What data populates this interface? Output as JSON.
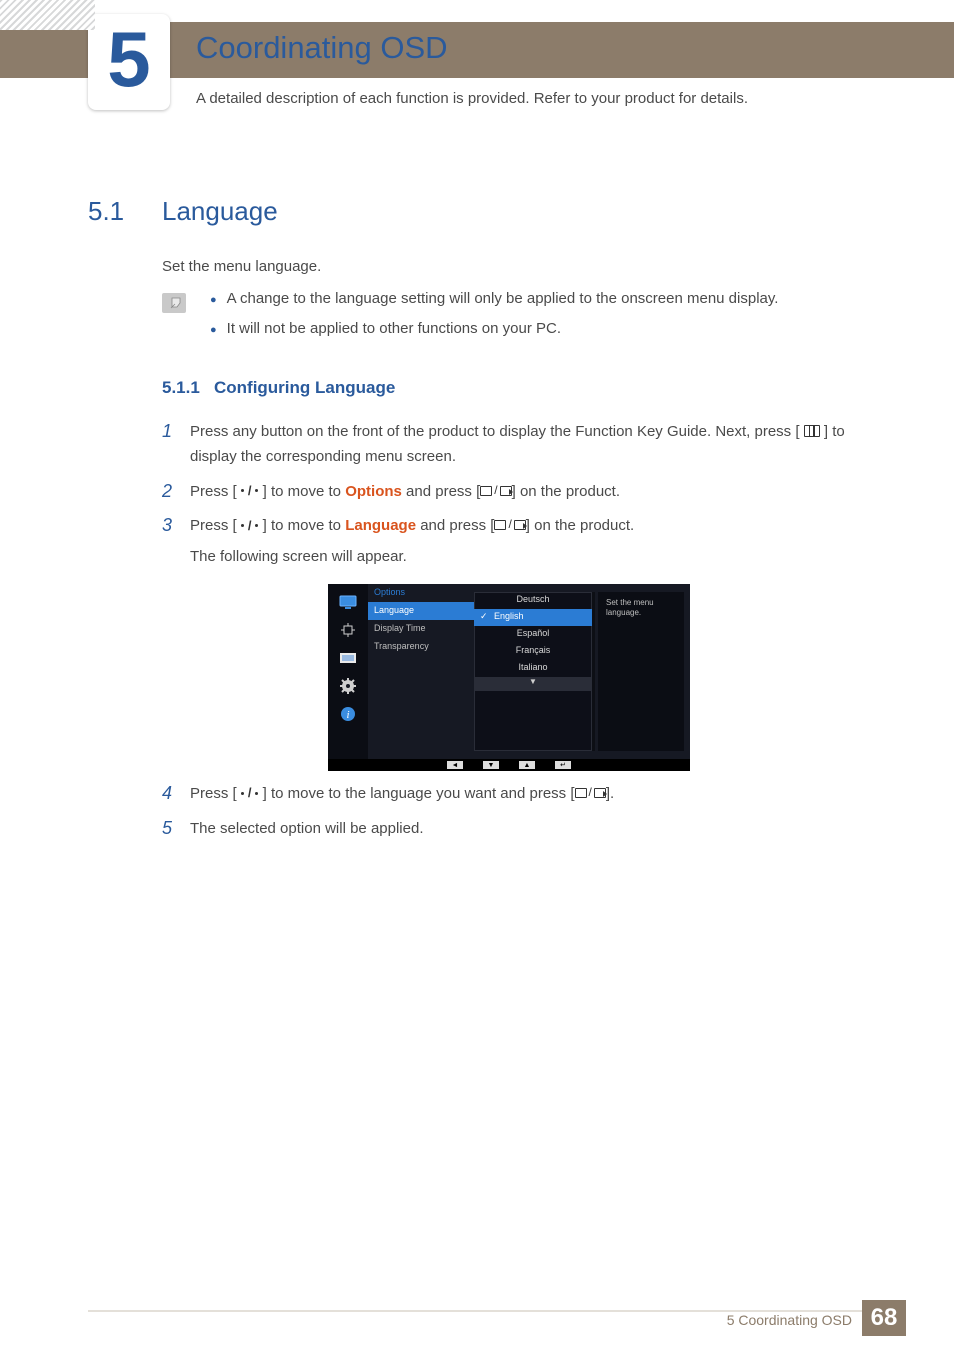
{
  "chapter": {
    "number": "5",
    "title": "Coordinating OSD",
    "description": "A detailed description of each function is provided. Refer to your product for details."
  },
  "section": {
    "number": "5.1",
    "title": "Language",
    "intro": "Set the menu language."
  },
  "notes": {
    "item1": "A change to the language setting will only be applied to the onscreen menu display.",
    "item2": "It will not be applied to other functions on your PC."
  },
  "subsection": {
    "number": "5.1.1",
    "title": "Configuring Language"
  },
  "steps": {
    "s1a": "Press any button on the front of the product to display the Function Key Guide. Next, press [ ",
    "s1b": " ] to display the corresponding menu screen.",
    "s2a": "Press [ ",
    "s2b": " ] to move to ",
    "s2opt": "Options",
    "s2c": " and press [",
    "s2d": "] on the product.",
    "s3a": "Press [ ",
    "s3b": " ] to move to ",
    "s3opt": "Language",
    "s3c": " and press [",
    "s3d": "] on the product.",
    "s3e": "The following screen will appear.",
    "s4a": "Press [ ",
    "s4b": " ] to move to the language you want and press [",
    "s4c": "].",
    "s5": "The selected option will be applied."
  },
  "osd": {
    "tab": "Options",
    "menu": {
      "language": "Language",
      "displayTime": "Display Time",
      "transparency": "Transparency"
    },
    "langs": {
      "de": "Deutsch",
      "en": "English",
      "es": "Español",
      "fr": "Français",
      "it": "Italiano"
    },
    "help": "Set the menu language."
  },
  "footer": {
    "chapter": "5 Coordinating OSD",
    "page": "68"
  }
}
